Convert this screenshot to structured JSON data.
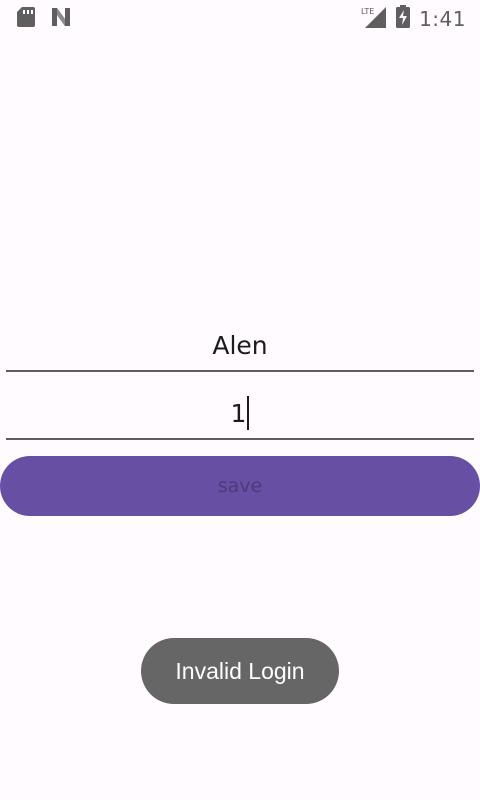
{
  "status_bar": {
    "time": "1:41",
    "network_label": "LTE",
    "icons": [
      "sd-card-icon",
      "n-logo-icon",
      "lte-signal-icon",
      "battery-charging-icon"
    ]
  },
  "form": {
    "username_value": "Alen",
    "password_value": "1",
    "save_label": "save"
  },
  "toast": {
    "message": "Invalid Login"
  },
  "colors": {
    "background": "#fffbfe",
    "primary": "#6750a4",
    "toast_bg": "#666666",
    "underline": "#5f5a63"
  }
}
